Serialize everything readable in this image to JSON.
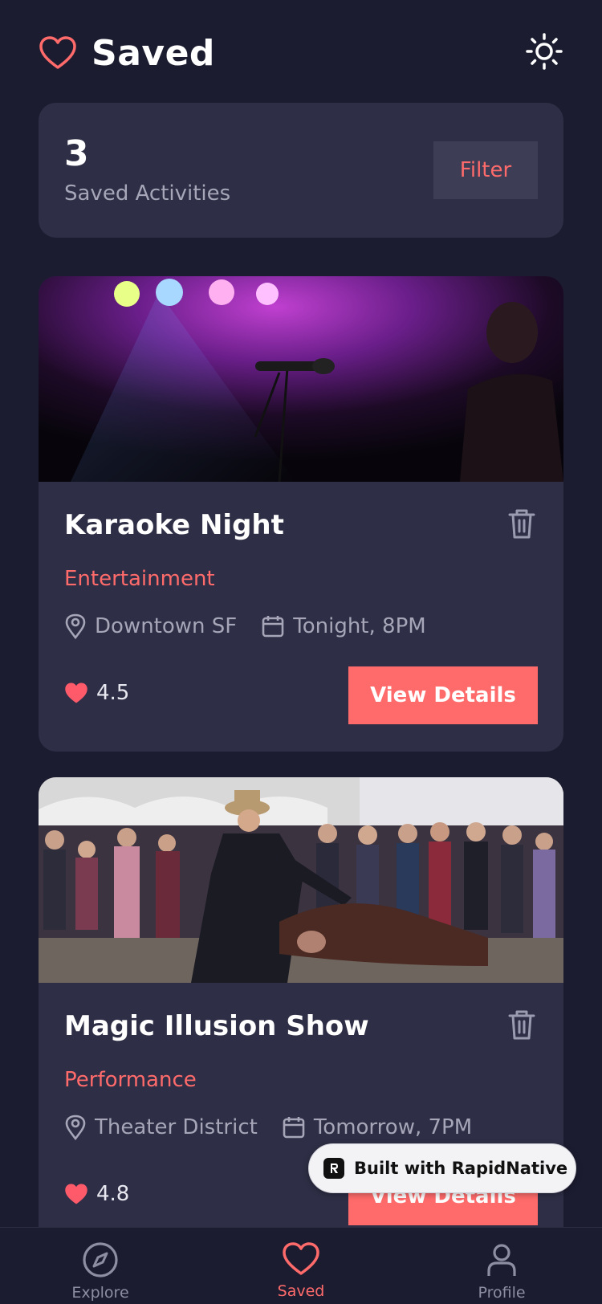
{
  "header": {
    "title": "Saved",
    "heart_icon": "heart-outline-icon",
    "theme_icon": "sun-icon"
  },
  "stats": {
    "count": "3",
    "label": "Saved Activities",
    "filter_label": "Filter"
  },
  "activities": [
    {
      "name": "Karaoke Night",
      "category": "Entertainment",
      "location": "Downtown SF",
      "time": "Tonight, 8PM",
      "rating": "4.5",
      "button_label": "View Details"
    },
    {
      "name": "Magic Illusion Show",
      "category": "Performance",
      "location": "Theater District",
      "time": "Tomorrow, 7PM",
      "rating": "4.8",
      "button_label": "View Details"
    }
  ],
  "badge": {
    "text": "Built with RapidNative"
  },
  "tabs": [
    {
      "label": "Explore",
      "icon": "compass-icon",
      "active": false
    },
    {
      "label": "Saved",
      "icon": "heart-icon",
      "active": true
    },
    {
      "label": "Profile",
      "icon": "person-icon",
      "active": false
    }
  ],
  "colors": {
    "background": "#1c1c31",
    "card": "#2e2e46",
    "accent": "#ff6b6b",
    "muted": "#a6a6b8"
  }
}
